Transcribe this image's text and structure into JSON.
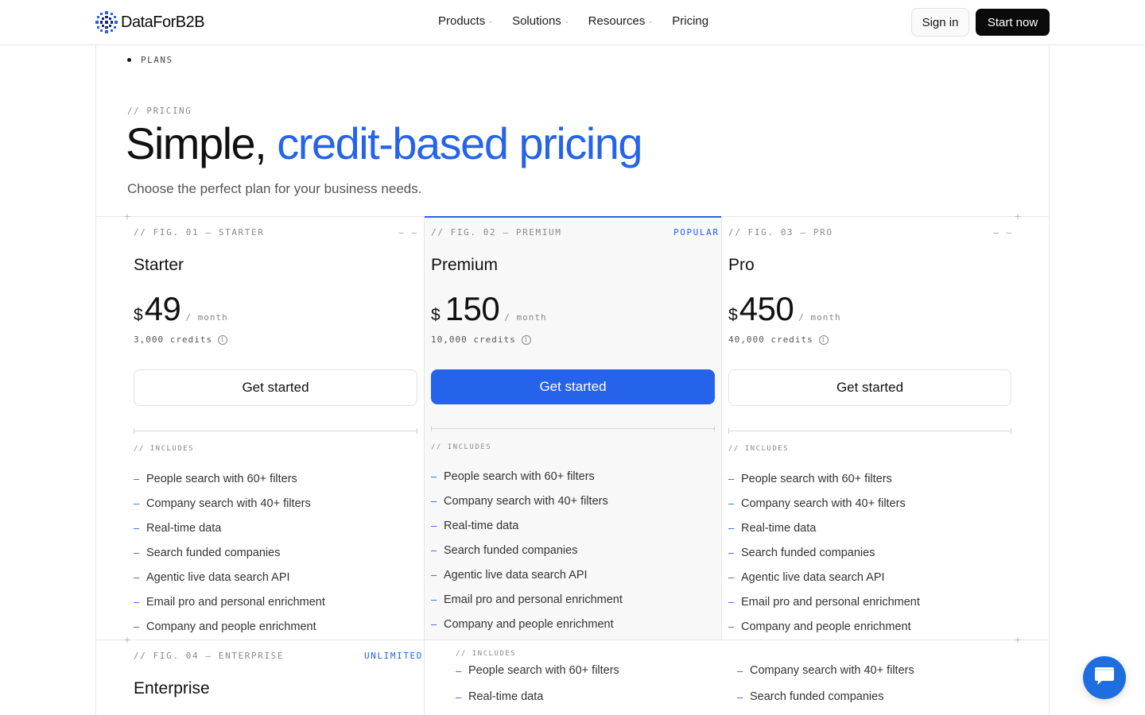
{
  "nav": {
    "logo_text": "DataForB2B",
    "links": [
      {
        "label": "Products",
        "caret": true
      },
      {
        "label": "Solutions",
        "caret": true
      },
      {
        "label": "Resources",
        "caret": true
      },
      {
        "label": "Pricing",
        "caret": false
      }
    ],
    "caret_glyph": "⌄",
    "signin_label": "Sign in",
    "start_label": "Start now"
  },
  "section_label": "PLANS",
  "hero": {
    "eyebrow": "// PRICING",
    "title_plain": "Simple, ",
    "title_accent": "credit-based pricing",
    "subtitle": "Choose the perfect plan for your business needs."
  },
  "colors": {
    "accent": "#2563eb",
    "dark": "#0a0a0a",
    "chat": "#1d6fe0"
  },
  "plans": [
    {
      "fig": "// FIG. 01 — STARTER",
      "tag": "— —",
      "name": "Starter",
      "currency": "$",
      "price": "49",
      "per": "/ month",
      "credits": "3,000 credits",
      "cta": "Get started",
      "includes_label": "// INCLUDES"
    },
    {
      "fig": "// FIG. 02 — PREMIUM",
      "tag": "POPULAR",
      "name": "Premium",
      "currency": "$",
      "price": "150",
      "per": "/ month",
      "credits": "10,000 credits",
      "cta": "Get started",
      "includes_label": "// INCLUDES"
    },
    {
      "fig": "// FIG. 03 — PRO",
      "tag": "— —",
      "name": "Pro",
      "currency": "$",
      "price": "450",
      "per": "/ month",
      "credits": "40,000 credits",
      "cta": "Get started",
      "includes_label": "// INCLUDES"
    }
  ],
  "features": [
    "People search with 60+ filters",
    "Company search with 40+ filters",
    "Real-time data",
    "Search funded companies",
    "Agentic live data search API",
    "Email pro and personal enrichment",
    "Company and people enrichment"
  ],
  "enterprise": {
    "fig": "// FIG. 04 — ENTERPRISE",
    "tag": "UNLIMITED",
    "name": "Enterprise",
    "includes_label": "// INCLUDES",
    "features": [
      "People search with 60+ filters",
      "Company search with 40+ filters",
      "Real-time data",
      "Search funded companies"
    ]
  },
  "bullet": "–",
  "info_glyph": "i",
  "plus_glyph": "+",
  "icons": {
    "logo": "logo-mark-icon",
    "chat": "chat-bubble-icon",
    "info": "info-icon"
  }
}
